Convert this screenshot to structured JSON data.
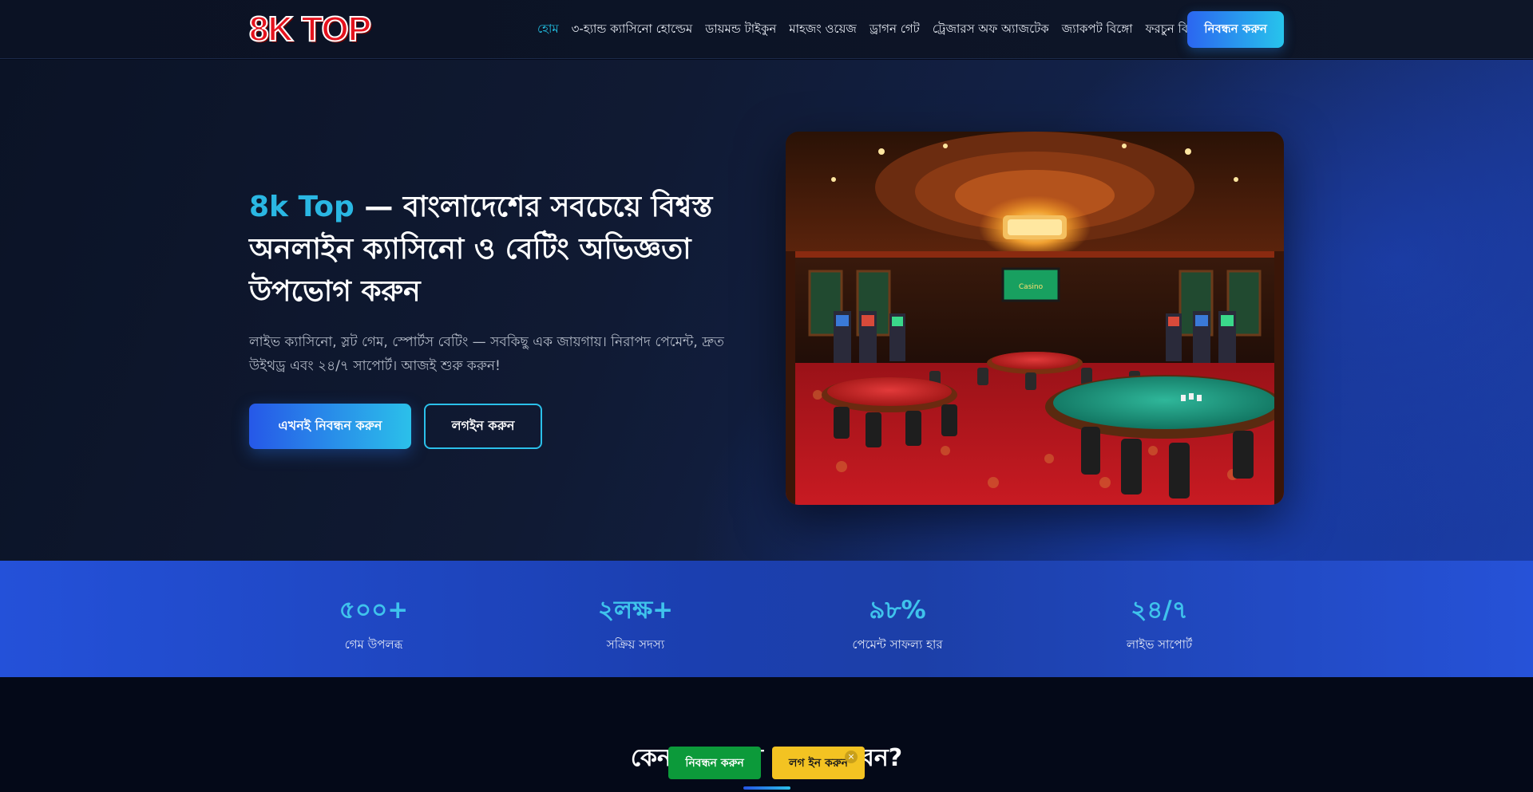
{
  "logo": {
    "text": "8K TOP"
  },
  "nav": {
    "items": [
      {
        "label": "হোম",
        "active": true
      },
      {
        "label": "৩-হ্যান্ড ক্যাসিনো হোল্ডেম",
        "active": false
      },
      {
        "label": "ডায়মন্ড টাইকুন",
        "active": false
      },
      {
        "label": "মাহজং ওয়েজ",
        "active": false
      },
      {
        "label": "ড্রাগন গেট",
        "active": false
      },
      {
        "label": "ট্রেজারস অফ অ্যাজটেক",
        "active": false
      },
      {
        "label": "জ্যাকপট বিঙ্গো",
        "active": false
      },
      {
        "label": "ফরচুন বিঙ্গো",
        "active": false
      }
    ],
    "register_label": "নিবন্ধন করুন"
  },
  "hero": {
    "brand": "8k Top",
    "title_rest": " — বাংলাদেশের সবচেয়ে বিশ্বস্ত অনলাইন ক্যাসিনো ও বেটিং অভিজ্ঞতা উপভোগ করুন",
    "subtitle": "লাইভ ক্যাসিনো, স্লট গেম, স্পোর্টস বেটিং — সবকিছু এক জায়গায়। নিরাপদ পেমেন্ট, দ্রুত উইথড্র এবং ২৪/৭ সাপোর্ট। আজই শুরু করুন!",
    "primary_button": "এখনই নিবন্ধন করুন",
    "secondary_button": "লগইন করুন",
    "image_sign": "Casino"
  },
  "stats": [
    {
      "value": "৫০০+",
      "label": "গেম উপলব্ধ"
    },
    {
      "value": "২লক্ষ+",
      "label": "সক্রিয় সদস্য"
    },
    {
      "value": "৯৮%",
      "label": "পেমেন্ট সাফল্য হার"
    },
    {
      "value": "২৪/৭",
      "label": "লাইভ সাপোর্ট"
    }
  ],
  "features": {
    "title": "কেন আমাদের বেছে নেবেন?"
  },
  "sticky": {
    "register_label": "নিবন্ধন করুন",
    "login_label": "লগ ইন করুন",
    "close_symbol": "×"
  },
  "colors": {
    "accent": "#22c3e6",
    "primary_blue": "#2658e8",
    "sticky_green": "#0c9a3a",
    "sticky_yellow": "#f3c322",
    "logo_red": "#e5121d"
  }
}
